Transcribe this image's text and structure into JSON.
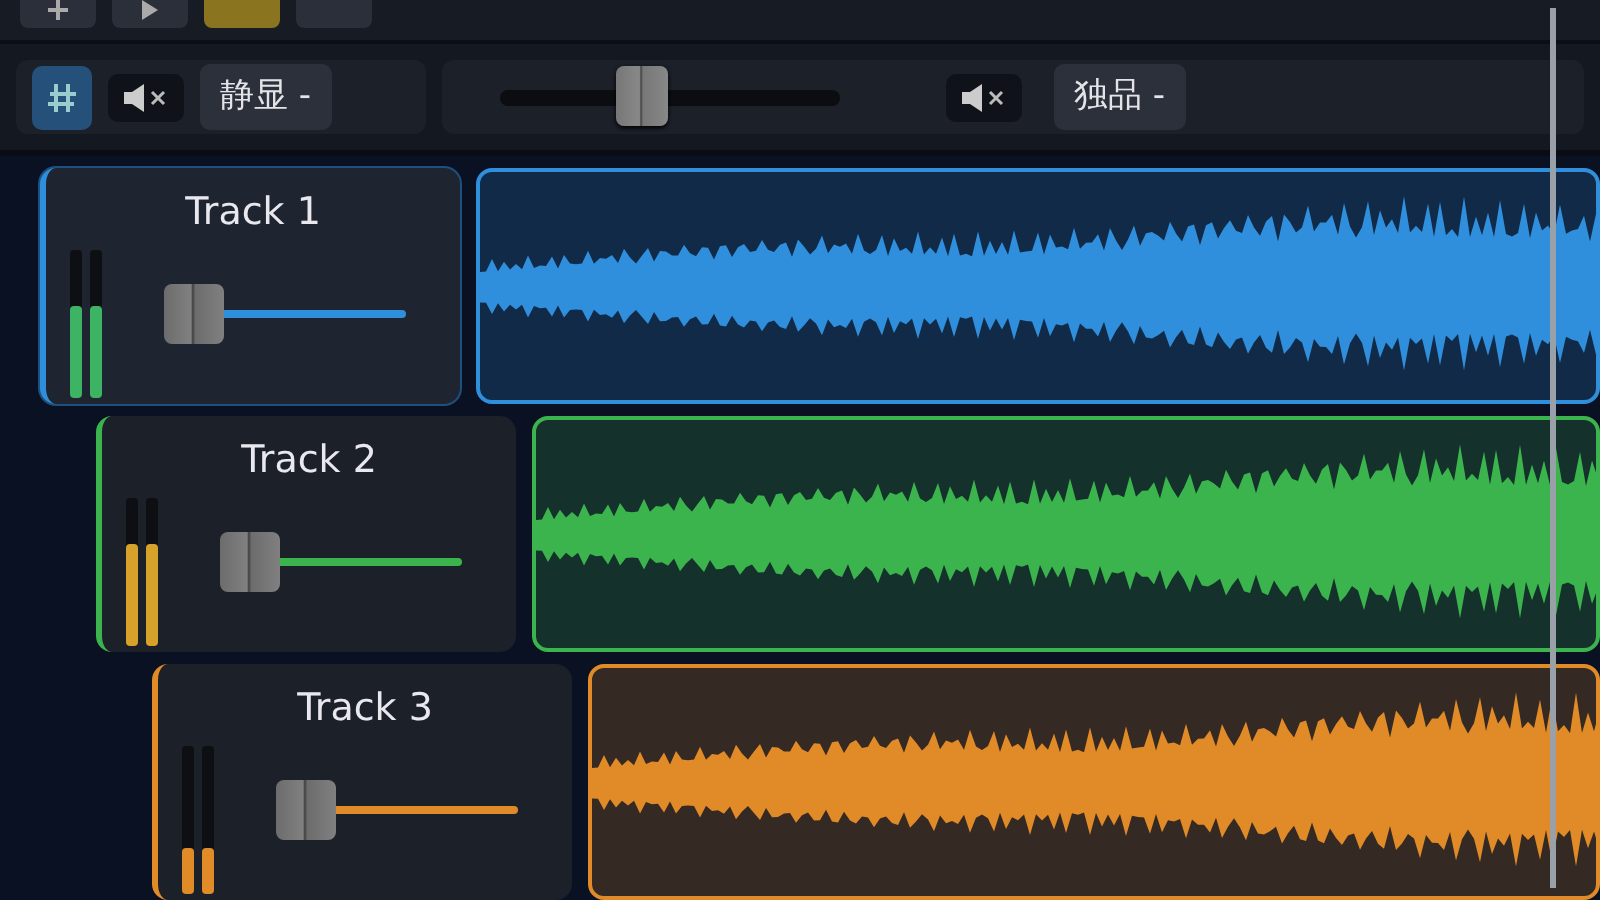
{
  "toolbar": {
    "record_armed": true
  },
  "controls": {
    "mute_button": {
      "label": "静显 -"
    },
    "master": {
      "level": 0.42
    },
    "solo_button": {
      "label": "独品 -"
    }
  },
  "tracks": [
    {
      "name": "Track 1",
      "selected": true,
      "color": "#2f8fdc",
      "meters": [
        {
          "level": 0.62,
          "color": "#3cb464"
        },
        {
          "level": 0.62,
          "color": "#3cb464"
        }
      ],
      "fader": {
        "level": 0.12
      }
    },
    {
      "name": "Track 2",
      "selected": false,
      "color": "#3cb44e",
      "meters": [
        {
          "level": 0.68,
          "color": "#d6a22a"
        },
        {
          "level": 0.68,
          "color": "#d6a22a"
        }
      ],
      "fader": {
        "level": 0.12
      }
    },
    {
      "name": "Track 3",
      "selected": false,
      "color": "#e08a28",
      "meters": [
        {
          "level": 0.3,
          "color": "#e08a28"
        },
        {
          "level": 0.3,
          "color": "#e08a28"
        }
      ],
      "fader": {
        "level": 0.12
      }
    }
  ]
}
